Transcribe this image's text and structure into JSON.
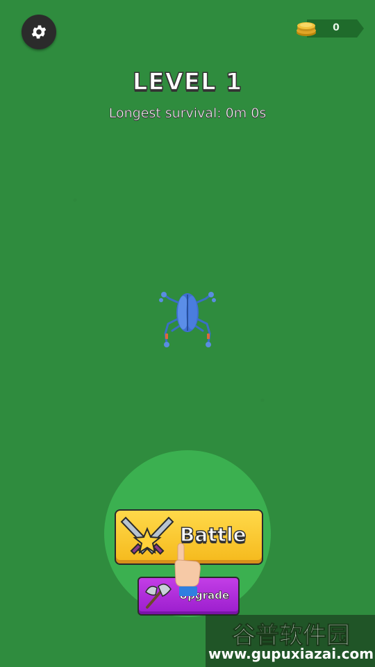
{
  "hud": {
    "settings_icon": "gear-icon",
    "coins": "0",
    "coin_icon": "coin-stack-icon"
  },
  "level": {
    "title": "LEVEL 1",
    "longest_survival": "Longest survival: 0m 0s"
  },
  "player": {
    "name_icon": "blue-beetle-icon"
  },
  "actions": {
    "battle_label": "Battle",
    "battle_icon": "crossed-swords-star-icon",
    "upgrade_label": "Upgrade",
    "upgrade_icon": "battle-axe-icon",
    "tutorial_icon": "pointing-hand-icon"
  },
  "watermark": {
    "title": "谷普软件园",
    "url": "www.gupuxiazai.com"
  },
  "colors": {
    "background": "#2f8c3e",
    "battle_button": "#f5b91c",
    "upgrade_button": "#a826d6",
    "zone": "#3db351"
  }
}
